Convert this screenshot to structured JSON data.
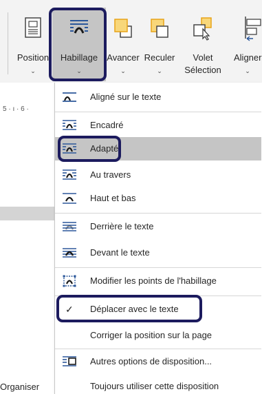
{
  "ribbon": {
    "buttons": [
      {
        "id": "position",
        "label": "Position",
        "label2": "",
        "icon": "position-icon"
      },
      {
        "id": "habillage",
        "label": "Habillage",
        "label2": "",
        "icon": "wrap-text-icon"
      },
      {
        "id": "avancer",
        "label": "Avancer",
        "label2": "",
        "icon": "bring-forward-icon"
      },
      {
        "id": "reculer",
        "label": "Reculer",
        "label2": "",
        "icon": "send-backward-icon"
      },
      {
        "id": "volet",
        "label": "Volet",
        "label2": "Sélection",
        "icon": "selection-pane-icon"
      },
      {
        "id": "aligner",
        "label": "Aligner",
        "label2": "",
        "icon": "align-icon"
      }
    ],
    "chevron": "⌄"
  },
  "doc": {
    "ruler": "5 · ı · 6 ·",
    "footer_label": "Organiser"
  },
  "menu": {
    "items": [
      {
        "label": "Aligné sur le texte",
        "icon": "inline-with-text-icon"
      },
      {
        "label": "Encadré",
        "icon": "square-wrap-icon"
      },
      {
        "label": "Adapté",
        "icon": "tight-wrap-icon",
        "selected": true
      },
      {
        "label": "Au travers",
        "icon": "through-wrap-icon"
      },
      {
        "label": "Haut et bas",
        "icon": "top-bottom-wrap-icon"
      },
      {
        "label": "Derrière le texte",
        "icon": "behind-text-icon"
      },
      {
        "label": "Devant le texte",
        "icon": "in-front-of-text-icon"
      },
      {
        "label": "Modifier les points de l'habillage",
        "icon": "edit-wrap-points-icon"
      },
      {
        "label": "Déplacer avec le texte",
        "icon": "check-icon",
        "checked": true
      },
      {
        "label": "Corriger la position sur la page",
        "icon": ""
      },
      {
        "label": "Autres options de disposition...",
        "icon": "layout-options-icon"
      },
      {
        "label": "Toujours utiliser cette disposition",
        "icon": ""
      }
    ],
    "check_glyph": "✓"
  },
  "colors": {
    "accent": "#1c1b5e",
    "icon_blue": "#2b579a",
    "selection_gray": "#c5c5c5",
    "orange": "#f0b429"
  }
}
